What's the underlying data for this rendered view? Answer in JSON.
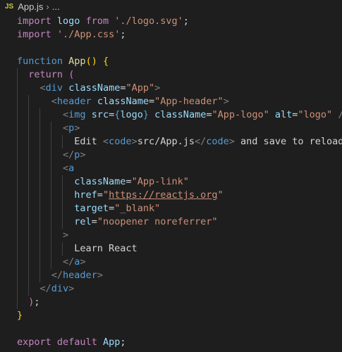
{
  "breadcrumb": {
    "file_icon": "JS",
    "file": "App.js",
    "sep": "›",
    "more": "..."
  },
  "colors": {
    "background": "#1e1e1e",
    "keyword": "#c586c0",
    "storage": "#569cd6",
    "variable": "#9cdcfe",
    "string": "#ce9178",
    "function": "#dcdcaa",
    "tag": "#569cd6",
    "punctuation": "#808080",
    "bracket_gold": "#ffd700",
    "bracket_orchid": "#da70d6",
    "bracket_blue": "#179fff"
  },
  "code": {
    "lines": [
      [
        {
          "t": "import",
          "c": "kw"
        },
        {
          "t": " ",
          "c": "txt"
        },
        {
          "t": "logo",
          "c": "var"
        },
        {
          "t": " ",
          "c": "txt"
        },
        {
          "t": "from",
          "c": "kw"
        },
        {
          "t": " ",
          "c": "txt"
        },
        {
          "t": "'./logo.svg'",
          "c": "str"
        },
        {
          "t": ";",
          "c": "txt"
        }
      ],
      [
        {
          "t": "import",
          "c": "kw"
        },
        {
          "t": " ",
          "c": "txt"
        },
        {
          "t": "'./App.css'",
          "c": "str"
        },
        {
          "t": ";",
          "c": "txt"
        }
      ],
      [],
      [
        {
          "t": "function",
          "c": "kwb"
        },
        {
          "t": " ",
          "c": "txt"
        },
        {
          "t": "App",
          "c": "fn"
        },
        {
          "t": "()",
          "c": "br1"
        },
        {
          "t": " ",
          "c": "txt"
        },
        {
          "t": "{",
          "c": "br1"
        }
      ],
      [
        {
          "t": "  ",
          "c": "txt"
        },
        {
          "t": "return",
          "c": "kw"
        },
        {
          "t": " ",
          "c": "txt"
        },
        {
          "t": "(",
          "c": "br2"
        }
      ],
      [
        {
          "t": "    ",
          "c": "txt"
        },
        {
          "t": "<",
          "c": "tagp"
        },
        {
          "t": "div",
          "c": "tag"
        },
        {
          "t": " ",
          "c": "txt"
        },
        {
          "t": "className",
          "c": "attr"
        },
        {
          "t": "=",
          "c": "txt"
        },
        {
          "t": "\"App\"",
          "c": "str"
        },
        {
          "t": ">",
          "c": "tagp"
        }
      ],
      [
        {
          "t": "      ",
          "c": "txt"
        },
        {
          "t": "<",
          "c": "tagp"
        },
        {
          "t": "header",
          "c": "tag"
        },
        {
          "t": " ",
          "c": "txt"
        },
        {
          "t": "className",
          "c": "attr"
        },
        {
          "t": "=",
          "c": "txt"
        },
        {
          "t": "\"App-header\"",
          "c": "str"
        },
        {
          "t": ">",
          "c": "tagp"
        }
      ],
      [
        {
          "t": "        ",
          "c": "txt"
        },
        {
          "t": "<",
          "c": "tagp"
        },
        {
          "t": "img",
          "c": "tag"
        },
        {
          "t": " ",
          "c": "txt"
        },
        {
          "t": "src",
          "c": "attr"
        },
        {
          "t": "=",
          "c": "txt"
        },
        {
          "t": "{",
          "c": "kwb"
        },
        {
          "t": "logo",
          "c": "var"
        },
        {
          "t": "}",
          "c": "kwb"
        },
        {
          "t": " ",
          "c": "txt"
        },
        {
          "t": "className",
          "c": "attr"
        },
        {
          "t": "=",
          "c": "txt"
        },
        {
          "t": "\"App-logo\"",
          "c": "str"
        },
        {
          "t": " ",
          "c": "txt"
        },
        {
          "t": "alt",
          "c": "attr"
        },
        {
          "t": "=",
          "c": "txt"
        },
        {
          "t": "\"logo\"",
          "c": "str"
        },
        {
          "t": " ",
          "c": "txt"
        },
        {
          "t": "/>",
          "c": "tagp"
        }
      ],
      [
        {
          "t": "        ",
          "c": "txt"
        },
        {
          "t": "<",
          "c": "tagp"
        },
        {
          "t": "p",
          "c": "tag"
        },
        {
          "t": ">",
          "c": "tagp"
        }
      ],
      [
        {
          "t": "          ",
          "c": "txt"
        },
        {
          "t": "Edit ",
          "c": "txt"
        },
        {
          "t": "<",
          "c": "tagp"
        },
        {
          "t": "code",
          "c": "tag"
        },
        {
          "t": ">",
          "c": "tagp"
        },
        {
          "t": "src/App.js",
          "c": "txt"
        },
        {
          "t": "</",
          "c": "tagp"
        },
        {
          "t": "code",
          "c": "tag"
        },
        {
          "t": ">",
          "c": "tagp"
        },
        {
          "t": " and save to reload.",
          "c": "txt"
        }
      ],
      [
        {
          "t": "        ",
          "c": "txt"
        },
        {
          "t": "</",
          "c": "tagp"
        },
        {
          "t": "p",
          "c": "tag"
        },
        {
          "t": ">",
          "c": "tagp"
        }
      ],
      [
        {
          "t": "        ",
          "c": "txt"
        },
        {
          "t": "<",
          "c": "tagp"
        },
        {
          "t": "a",
          "c": "tag"
        }
      ],
      [
        {
          "t": "          ",
          "c": "txt"
        },
        {
          "t": "className",
          "c": "attr"
        },
        {
          "t": "=",
          "c": "txt"
        },
        {
          "t": "\"App-link\"",
          "c": "str"
        }
      ],
      [
        {
          "t": "          ",
          "c": "txt"
        },
        {
          "t": "href",
          "c": "attr"
        },
        {
          "t": "=",
          "c": "txt"
        },
        {
          "t": "\"",
          "c": "str"
        },
        {
          "t": "https://reactjs.org",
          "c": "str url"
        },
        {
          "t": "\"",
          "c": "str"
        }
      ],
      [
        {
          "t": "          ",
          "c": "txt"
        },
        {
          "t": "target",
          "c": "attr"
        },
        {
          "t": "=",
          "c": "txt"
        },
        {
          "t": "\"_blank\"",
          "c": "str"
        }
      ],
      [
        {
          "t": "          ",
          "c": "txt"
        },
        {
          "t": "rel",
          "c": "attr"
        },
        {
          "t": "=",
          "c": "txt"
        },
        {
          "t": "\"noopener noreferrer\"",
          "c": "str"
        }
      ],
      [
        {
          "t": "        ",
          "c": "txt"
        },
        {
          "t": ">",
          "c": "tagp"
        }
      ],
      [
        {
          "t": "          ",
          "c": "txt"
        },
        {
          "t": "Learn React",
          "c": "txt"
        }
      ],
      [
        {
          "t": "        ",
          "c": "txt"
        },
        {
          "t": "</",
          "c": "tagp"
        },
        {
          "t": "a",
          "c": "tag"
        },
        {
          "t": ">",
          "c": "tagp"
        }
      ],
      [
        {
          "t": "      ",
          "c": "txt"
        },
        {
          "t": "</",
          "c": "tagp"
        },
        {
          "t": "header",
          "c": "tag"
        },
        {
          "t": ">",
          "c": "tagp"
        }
      ],
      [
        {
          "t": "    ",
          "c": "txt"
        },
        {
          "t": "</",
          "c": "tagp"
        },
        {
          "t": "div",
          "c": "tag"
        },
        {
          "t": ">",
          "c": "tagp"
        }
      ],
      [
        {
          "t": "  ",
          "c": "txt"
        },
        {
          "t": ")",
          "c": "br2"
        },
        {
          "t": ";",
          "c": "txt"
        }
      ],
      [
        {
          "t": "}",
          "c": "br1"
        }
      ],
      [],
      [
        {
          "t": "export",
          "c": "kw"
        },
        {
          "t": " ",
          "c": "txt"
        },
        {
          "t": "default",
          "c": "kw"
        },
        {
          "t": " ",
          "c": "txt"
        },
        {
          "t": "App",
          "c": "var"
        },
        {
          "t": ";",
          "c": "txt"
        }
      ]
    ]
  }
}
